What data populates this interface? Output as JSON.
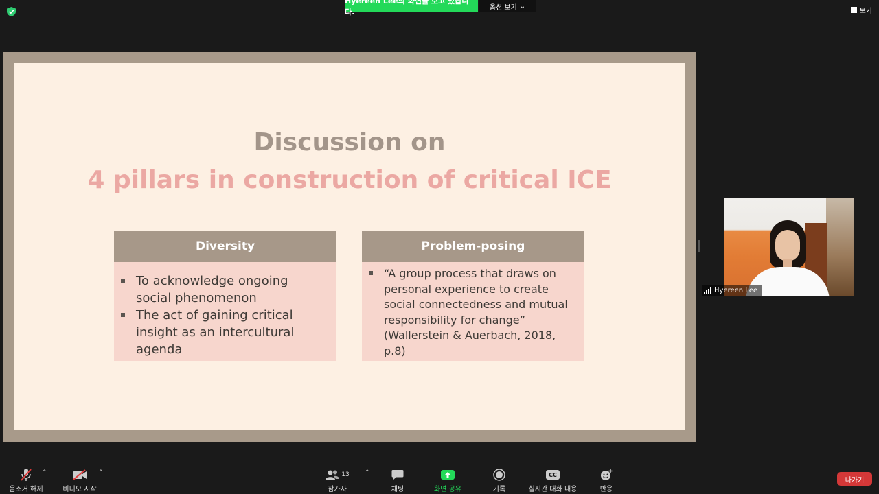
{
  "top_bar": {
    "share_banner": "Hyereen Lee의 화면을 보고 있습니다.",
    "options_label": "옵션 보기",
    "view_label": "보기"
  },
  "slide": {
    "title_line1": "Discussion on",
    "title_line2": "4 pillars in construction of critical ICE",
    "cards": [
      {
        "heading": "Diversity",
        "bullets": [
          "To acknowledge ongoing social phenomenon",
          "The act of gaining critical insight as an intercultural agenda"
        ]
      },
      {
        "heading": "Problem-posing",
        "bullets": [
          "“A group process that draws on personal experience to create social connectedness and mutual responsibility for change” (Wallerstein & Auerbach, 2018, p.8)"
        ]
      }
    ]
  },
  "participant": {
    "name": "Hyereen Lee"
  },
  "toolbar": {
    "unmute": "음소거 해제",
    "start_video": "비디오 시작",
    "participants": "참가자",
    "participants_count": "13",
    "chat": "채팅",
    "share_screen": "화면 공유",
    "record": "기록",
    "live_transcript": "실시간 대화 내용",
    "reactions": "반응",
    "leave": "나가기",
    "cc_text": "CC"
  },
  "colors": {
    "share_banner": "#23d959",
    "leave": "#d43838",
    "title_gray": "#a3958a",
    "title_pink": "#eba8a3",
    "card_header": "#a79889",
    "card_body": "#f7d6cd",
    "slide_bg": "#fdf0e3"
  },
  "icons": [
    "shield-icon",
    "grid-icon",
    "microphone-muted-icon",
    "video-off-icon",
    "participants-icon",
    "chat-icon",
    "share-screen-icon",
    "record-icon",
    "closed-caption-icon",
    "reaction-icon",
    "signal-bars-icon",
    "chevron-up-icon",
    "chevron-down-icon"
  ]
}
